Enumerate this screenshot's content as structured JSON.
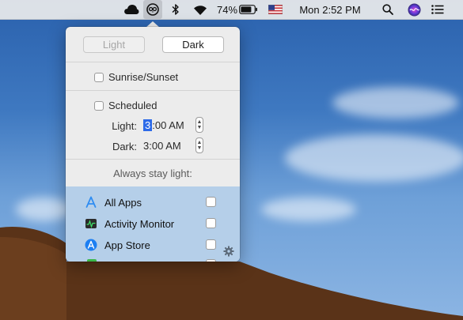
{
  "menubar": {
    "battery": "74%",
    "clock": "Mon 2:52 PM",
    "icons": [
      "creative-cloud-icon",
      "night-owl-icon",
      "bluetooth-icon",
      "wifi-icon",
      "battery-icon",
      "us-flag-icon",
      "spotlight-search-icon",
      "siri-icon",
      "notification-center-icon"
    ]
  },
  "popover": {
    "mode": {
      "light_label": "Light",
      "dark_label": "Dark",
      "selected": "Dark"
    },
    "sunrise_label": "Sunrise/Sunset",
    "scheduled_label": "Scheduled",
    "schedule": {
      "light_label": "Light:",
      "light_hour": "3",
      "light_rest": ":00 AM",
      "dark_label": "Dark:",
      "dark_time": "3:00 AM"
    },
    "always_light_label": "Always stay light:",
    "apps": [
      {
        "name": "All Apps",
        "icon": "app-store-a-icon"
      },
      {
        "name": "Activity Monitor",
        "icon": "activity-monitor-icon"
      },
      {
        "name": "App Store",
        "icon": "app-store-icon"
      }
    ]
  },
  "colors": {
    "accent": "#2c6ae8",
    "apps_background": "#b5cfe9"
  }
}
